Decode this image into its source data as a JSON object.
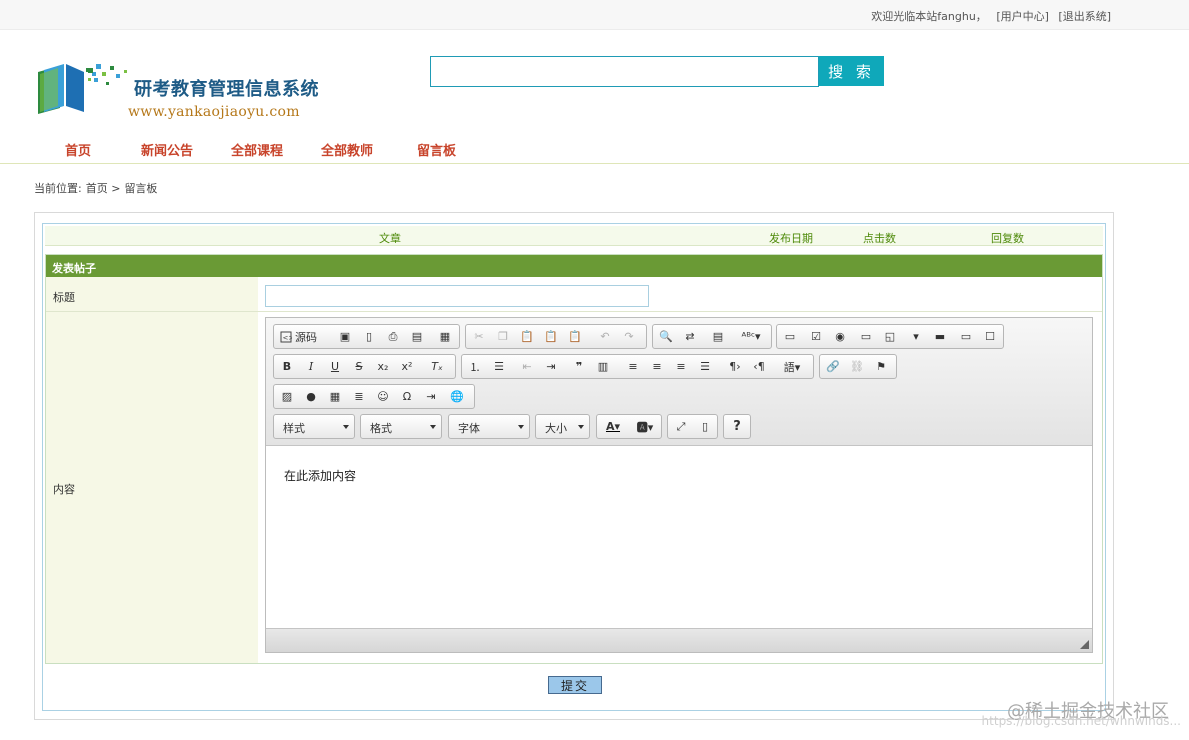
{
  "topbar": {
    "welcome": "欢迎光临本站fanghu，",
    "user_center": "[用户中心]",
    "logout": "[退出系统]"
  },
  "logo": {
    "title": "研考教育管理信息系统",
    "url": "www.yankaojiaoyu.com"
  },
  "search": {
    "value": "",
    "button": "搜 索"
  },
  "nav": [
    {
      "label": "首页"
    },
    {
      "label": "新闻公告"
    },
    {
      "label": "全部课程"
    },
    {
      "label": "全部教师"
    },
    {
      "label": "留言板"
    }
  ],
  "breadcrumb": {
    "prefix": "当前位置:",
    "home": "首页 >",
    "current": "留言板"
  },
  "list_header": {
    "article": "文章",
    "date": "发布日期",
    "clicks": "点击数",
    "replies": "回复数"
  },
  "form": {
    "header": "发表帖子",
    "title_label": "标题",
    "title_value": "",
    "content_label": "内容",
    "content_placeholder": "在此添加内容",
    "submit": "提交"
  },
  "editor": {
    "source_label": "源码",
    "combos": {
      "styles": "样式",
      "format": "格式",
      "font": "字体",
      "size": "大小"
    }
  },
  "watermark": {
    "main": "@稀土掘金技术社区",
    "sub": "https://blog.csdn.net/whnwinds..."
  }
}
